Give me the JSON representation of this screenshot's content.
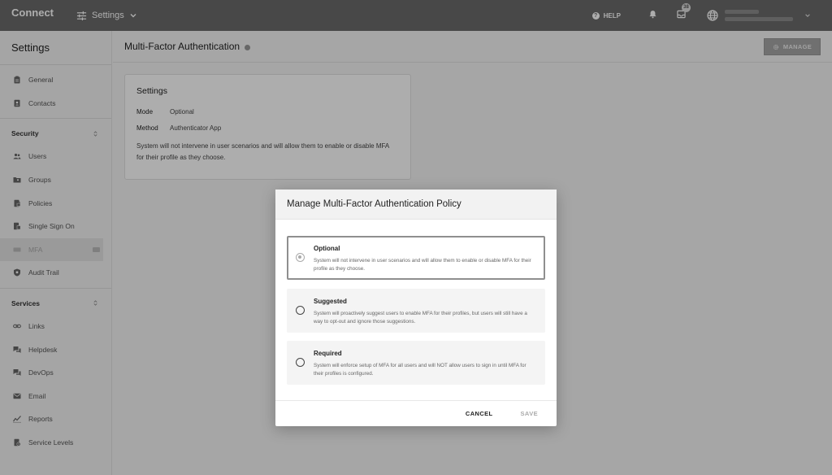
{
  "topbar": {
    "brand": "Connect",
    "settings_label": "Settings",
    "help_label": "HELP",
    "inbox_count": "38"
  },
  "sidebar": {
    "title": "Settings",
    "items_top": [
      {
        "label": "General",
        "icon": "clipboard-icon"
      },
      {
        "label": "Contacts",
        "icon": "contacts-icon"
      }
    ],
    "security": {
      "label": "Security",
      "items": [
        {
          "label": "Users",
          "icon": "users-icon"
        },
        {
          "label": "Groups",
          "icon": "groups-icon"
        },
        {
          "label": "Policies",
          "icon": "policies-icon"
        },
        {
          "label": "Single Sign On",
          "icon": "sso-icon"
        },
        {
          "label": "MFA",
          "icon": "mfa-icon"
        },
        {
          "label": "Audit Trail",
          "icon": "audit-icon"
        }
      ]
    },
    "services": {
      "label": "Services",
      "items": [
        {
          "label": "Links",
          "icon": "link-icon"
        },
        {
          "label": "Helpdesk",
          "icon": "helpdesk-icon"
        },
        {
          "label": "DevOps",
          "icon": "devops-icon"
        },
        {
          "label": "Email",
          "icon": "email-icon"
        },
        {
          "label": "Reports",
          "icon": "reports-icon"
        },
        {
          "label": "Service Levels",
          "icon": "service-levels-icon"
        }
      ]
    }
  },
  "main": {
    "title": "Multi-Factor Authentication",
    "manage_label": "MANAGE",
    "card": {
      "title": "Settings",
      "mode_key": "Mode",
      "mode_value": "Optional",
      "method_key": "Method",
      "method_value": "Authenticator App",
      "description": "System will not intervene in user scenarios and will allow them to enable or disable MFA for their profile as they choose."
    }
  },
  "modal": {
    "title": "Manage Multi-Factor Authentication Policy",
    "options": [
      {
        "title": "Optional",
        "desc": "System will not intervene in user scenarios and will allow them to enable or disable MFA for their profile as they choose.",
        "selected": true
      },
      {
        "title": "Suggested",
        "desc": "System will proactively suggest users to enable MFA for their profiles, but users will still have a way to opt-out and ignore those suggestions.",
        "selected": false
      },
      {
        "title": "Required",
        "desc": "System will enforce setup of MFA for all users and will NOT allow users to sign in until MFA for their profiles is configured.",
        "selected": false
      }
    ],
    "cancel_label": "CANCEL",
    "save_label": "SAVE"
  }
}
